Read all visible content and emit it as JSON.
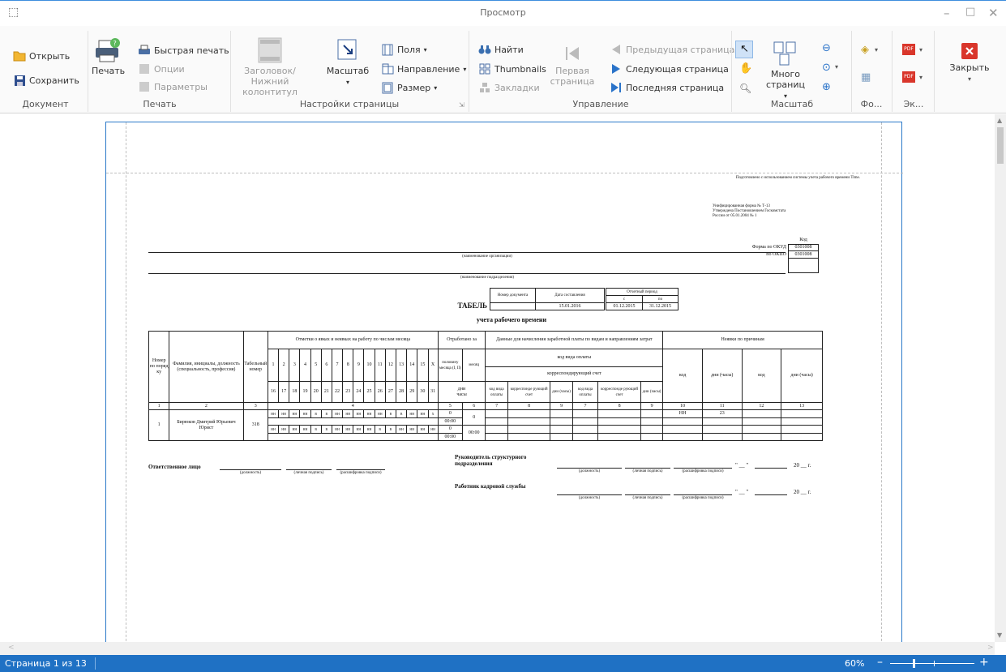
{
  "window": {
    "title": "Просмотр"
  },
  "ribbon": {
    "document": {
      "open": "Открыть",
      "save": "Сохранить",
      "group": "Документ"
    },
    "print": {
      "print": "Печать",
      "quick_print": "Быстрая печать",
      "options": "Опции",
      "parameters": "Параметры",
      "group": "Печать"
    },
    "page_setup": {
      "header_footer": "Заголовок/Нижний колонтитул",
      "scale": "Масштаб",
      "margins": "Поля",
      "orientation": "Направление",
      "size": "Размер",
      "group": "Настройки страницы"
    },
    "navigation": {
      "find": "Найти",
      "thumbnails": "Thumbnails",
      "bookmarks": "Закладки",
      "first_page": "Первая страница",
      "prev_page": "Предыдущая страница",
      "next_page": "Следующая страница",
      "last_page": "Последняя страница",
      "group": "Управление"
    },
    "zoom": {
      "many_pages": "Много страниц",
      "group": "Масштаб"
    },
    "background": {
      "group": "Фо..."
    },
    "export": {
      "group": "Эк..."
    },
    "close": {
      "label": "Закрыть"
    }
  },
  "document": {
    "header_note": "Подготовлено с использованием системы учета рабочего времени Time.",
    "form_info": [
      "Унифицированная форма № Т-13",
      "Утверждена Постановлением Госкомстата",
      "России от 05.01.2004 № 1"
    ],
    "code_label": "Код",
    "okud_label": "Форма по ОКУД",
    "okud": "0301008",
    "okpo_label": "по ОКПО",
    "okpo": "0301008",
    "org_caption": "(наименование организации)",
    "dept_caption": "(наименование подразделения)",
    "doc_number_label": "Номер документа",
    "doc_date_label": "Дата составления",
    "doc_date": "15.01.2016",
    "period_label": "Отчетный период",
    "period_from_label": "с",
    "period_to_label": "по",
    "period_from": "01.12.2015",
    "period_to": "31.12.2015",
    "title": "ТАБЕЛЬ",
    "subtitle": "учета рабочего времени",
    "table": {
      "h_num": "Номер по поряд ку",
      "h_name": "Фамилия, инициалы, должность (специальность, профессия)",
      "h_tab": "Табельный номер",
      "h_marks": "Отметки о явках и неявках на работу по числам месяца",
      "h_worked": "Отработано за",
      "h_half": "половину месяца (I, II)",
      "h_month": "месяц",
      "h_days": "дни",
      "h_hours": "часы",
      "h_pay": "Данные для начисления заработной платы по видам и направлениям затрат",
      "h_paycode": "код вида оплаты",
      "h_account": "корреспондирующий счет",
      "h_paycode2": "код вида оплаты",
      "h_account2": "корреспонде рующий счет",
      "h_dayshours": "дни (часы)",
      "h_absence": "Неявки по причинам",
      "h_code": "код",
      "days_row1": [
        "1",
        "2",
        "3",
        "4",
        "5",
        "6",
        "7",
        "8",
        "9",
        "10",
        "11",
        "12",
        "13",
        "14",
        "15",
        "X"
      ],
      "days_row2": [
        "16",
        "17",
        "18",
        "19",
        "20",
        "21",
        "22",
        "23",
        "24",
        "25",
        "26",
        "27",
        "28",
        "29",
        "30",
        "31"
      ],
      "colnums": [
        "1",
        "2",
        "3",
        "4",
        "5",
        "6",
        "7",
        "8",
        "9",
        "7",
        "8",
        "9",
        "10",
        "11",
        "12",
        "13"
      ],
      "row": {
        "num": "1",
        "name": "Бирюков Дмитрий Юрьевич Юрист",
        "tab": "318",
        "marks1": [
          "НН",
          "НН",
          "НН",
          "НН",
          "В",
          "В",
          "НН",
          "НН",
          "НН",
          "НН",
          "НН",
          "В",
          "В",
          "НН",
          "НН",
          "Х"
        ],
        "marks2": [
          "НН",
          "НН",
          "НН",
          "НН",
          "В",
          "В",
          "НН",
          "НН",
          "НН",
          "НН",
          "В",
          "В",
          "НН",
          "НН",
          "НН",
          "НН"
        ],
        "half1": "0",
        "half1_time": "00:00",
        "half2": "0",
        "half2_time": "00:00",
        "month": "0",
        "month_time": "00:00",
        "absence_code": "НН",
        "absence_days": "23"
      }
    },
    "responsible_label": "Ответственное лицо",
    "head_label": "Руководитель структурного подразделения",
    "hr_label": "Работник кадровой службы",
    "pos_caption": "(должность)",
    "sign_caption": "(личная подпись)",
    "decode_caption": "(расшифровка подписи)",
    "date_tpl": "\" __ \"",
    "year_tpl": "20 __ г."
  },
  "status": {
    "page_info": "Страница 1 из 13",
    "zoom": "60%"
  },
  "colors": {
    "accent": "#1f71c4",
    "page_border": "#2b79c9"
  }
}
